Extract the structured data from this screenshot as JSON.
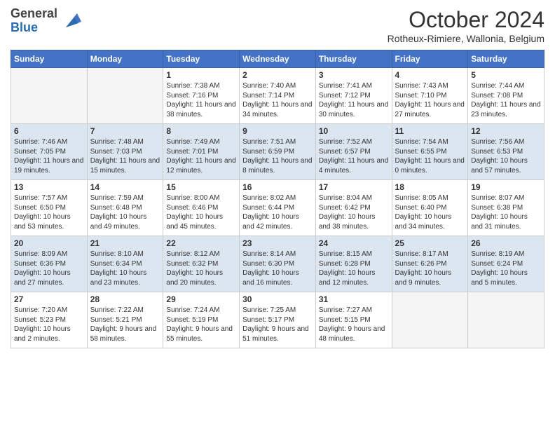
{
  "header": {
    "logo_line1": "General",
    "logo_line2": "Blue",
    "title": "October 2024",
    "subtitle": "Rotheux-Rimiere, Wallonia, Belgium"
  },
  "days_of_week": [
    "Sunday",
    "Monday",
    "Tuesday",
    "Wednesday",
    "Thursday",
    "Friday",
    "Saturday"
  ],
  "weeks": [
    [
      {
        "day": "",
        "sunrise": "",
        "sunset": "",
        "daylight": ""
      },
      {
        "day": "",
        "sunrise": "",
        "sunset": "",
        "daylight": ""
      },
      {
        "day": "1",
        "sunrise": "Sunrise: 7:38 AM",
        "sunset": "Sunset: 7:16 PM",
        "daylight": "Daylight: 11 hours and 38 minutes."
      },
      {
        "day": "2",
        "sunrise": "Sunrise: 7:40 AM",
        "sunset": "Sunset: 7:14 PM",
        "daylight": "Daylight: 11 hours and 34 minutes."
      },
      {
        "day": "3",
        "sunrise": "Sunrise: 7:41 AM",
        "sunset": "Sunset: 7:12 PM",
        "daylight": "Daylight: 11 hours and 30 minutes."
      },
      {
        "day": "4",
        "sunrise": "Sunrise: 7:43 AM",
        "sunset": "Sunset: 7:10 PM",
        "daylight": "Daylight: 11 hours and 27 minutes."
      },
      {
        "day": "5",
        "sunrise": "Sunrise: 7:44 AM",
        "sunset": "Sunset: 7:08 PM",
        "daylight": "Daylight: 11 hours and 23 minutes."
      }
    ],
    [
      {
        "day": "6",
        "sunrise": "Sunrise: 7:46 AM",
        "sunset": "Sunset: 7:05 PM",
        "daylight": "Daylight: 11 hours and 19 minutes."
      },
      {
        "day": "7",
        "sunrise": "Sunrise: 7:48 AM",
        "sunset": "Sunset: 7:03 PM",
        "daylight": "Daylight: 11 hours and 15 minutes."
      },
      {
        "day": "8",
        "sunrise": "Sunrise: 7:49 AM",
        "sunset": "Sunset: 7:01 PM",
        "daylight": "Daylight: 11 hours and 12 minutes."
      },
      {
        "day": "9",
        "sunrise": "Sunrise: 7:51 AM",
        "sunset": "Sunset: 6:59 PM",
        "daylight": "Daylight: 11 hours and 8 minutes."
      },
      {
        "day": "10",
        "sunrise": "Sunrise: 7:52 AM",
        "sunset": "Sunset: 6:57 PM",
        "daylight": "Daylight: 11 hours and 4 minutes."
      },
      {
        "day": "11",
        "sunrise": "Sunrise: 7:54 AM",
        "sunset": "Sunset: 6:55 PM",
        "daylight": "Daylight: 11 hours and 0 minutes."
      },
      {
        "day": "12",
        "sunrise": "Sunrise: 7:56 AM",
        "sunset": "Sunset: 6:53 PM",
        "daylight": "Daylight: 10 hours and 57 minutes."
      }
    ],
    [
      {
        "day": "13",
        "sunrise": "Sunrise: 7:57 AM",
        "sunset": "Sunset: 6:50 PM",
        "daylight": "Daylight: 10 hours and 53 minutes."
      },
      {
        "day": "14",
        "sunrise": "Sunrise: 7:59 AM",
        "sunset": "Sunset: 6:48 PM",
        "daylight": "Daylight: 10 hours and 49 minutes."
      },
      {
        "day": "15",
        "sunrise": "Sunrise: 8:00 AM",
        "sunset": "Sunset: 6:46 PM",
        "daylight": "Daylight: 10 hours and 45 minutes."
      },
      {
        "day": "16",
        "sunrise": "Sunrise: 8:02 AM",
        "sunset": "Sunset: 6:44 PM",
        "daylight": "Daylight: 10 hours and 42 minutes."
      },
      {
        "day": "17",
        "sunrise": "Sunrise: 8:04 AM",
        "sunset": "Sunset: 6:42 PM",
        "daylight": "Daylight: 10 hours and 38 minutes."
      },
      {
        "day": "18",
        "sunrise": "Sunrise: 8:05 AM",
        "sunset": "Sunset: 6:40 PM",
        "daylight": "Daylight: 10 hours and 34 minutes."
      },
      {
        "day": "19",
        "sunrise": "Sunrise: 8:07 AM",
        "sunset": "Sunset: 6:38 PM",
        "daylight": "Daylight: 10 hours and 31 minutes."
      }
    ],
    [
      {
        "day": "20",
        "sunrise": "Sunrise: 8:09 AM",
        "sunset": "Sunset: 6:36 PM",
        "daylight": "Daylight: 10 hours and 27 minutes."
      },
      {
        "day": "21",
        "sunrise": "Sunrise: 8:10 AM",
        "sunset": "Sunset: 6:34 PM",
        "daylight": "Daylight: 10 hours and 23 minutes."
      },
      {
        "day": "22",
        "sunrise": "Sunrise: 8:12 AM",
        "sunset": "Sunset: 6:32 PM",
        "daylight": "Daylight: 10 hours and 20 minutes."
      },
      {
        "day": "23",
        "sunrise": "Sunrise: 8:14 AM",
        "sunset": "Sunset: 6:30 PM",
        "daylight": "Daylight: 10 hours and 16 minutes."
      },
      {
        "day": "24",
        "sunrise": "Sunrise: 8:15 AM",
        "sunset": "Sunset: 6:28 PM",
        "daylight": "Daylight: 10 hours and 12 minutes."
      },
      {
        "day": "25",
        "sunrise": "Sunrise: 8:17 AM",
        "sunset": "Sunset: 6:26 PM",
        "daylight": "Daylight: 10 hours and 9 minutes."
      },
      {
        "day": "26",
        "sunrise": "Sunrise: 8:19 AM",
        "sunset": "Sunset: 6:24 PM",
        "daylight": "Daylight: 10 hours and 5 minutes."
      }
    ],
    [
      {
        "day": "27",
        "sunrise": "Sunrise: 7:20 AM",
        "sunset": "Sunset: 5:23 PM",
        "daylight": "Daylight: 10 hours and 2 minutes."
      },
      {
        "day": "28",
        "sunrise": "Sunrise: 7:22 AM",
        "sunset": "Sunset: 5:21 PM",
        "daylight": "Daylight: 9 hours and 58 minutes."
      },
      {
        "day": "29",
        "sunrise": "Sunrise: 7:24 AM",
        "sunset": "Sunset: 5:19 PM",
        "daylight": "Daylight: 9 hours and 55 minutes."
      },
      {
        "day": "30",
        "sunrise": "Sunrise: 7:25 AM",
        "sunset": "Sunset: 5:17 PM",
        "daylight": "Daylight: 9 hours and 51 minutes."
      },
      {
        "day": "31",
        "sunrise": "Sunrise: 7:27 AM",
        "sunset": "Sunset: 5:15 PM",
        "daylight": "Daylight: 9 hours and 48 minutes."
      },
      {
        "day": "",
        "sunrise": "",
        "sunset": "",
        "daylight": ""
      },
      {
        "day": "",
        "sunrise": "",
        "sunset": "",
        "daylight": ""
      }
    ]
  ]
}
